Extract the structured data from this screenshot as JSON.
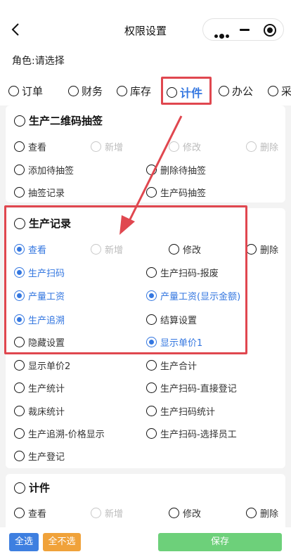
{
  "nav": {
    "title": "权限设置"
  },
  "role": {
    "label": "角色:请选择"
  },
  "tabs": [
    {
      "label": "订单"
    },
    {
      "label": "财务"
    },
    {
      "label": "库存"
    },
    {
      "label": "计件"
    },
    {
      "label": "办公"
    },
    {
      "label": "采"
    }
  ],
  "sections": [
    {
      "title": "生产二维码抽签",
      "options": [
        "查看",
        "新增",
        "修改",
        "删除",
        "添加待抽签",
        "删除待抽签",
        "抽签记录",
        "生产码抽签"
      ]
    },
    {
      "title": "生产记录",
      "options": [
        "查看",
        "新增",
        "修改",
        "删除",
        "生产扫码",
        "生产扫码-报废",
        "产量工资",
        "产量工资(显示金额)",
        "生产追溯",
        "结算设置",
        "隐藏设置",
        "显示单价1",
        "显示单价2",
        "生产合计",
        "生产统计",
        "生产扫码-直接登记",
        "裁床统计",
        "生产扫码统计",
        "生产追溯-价格显示",
        "生产扫码-选择员工",
        "生产登记"
      ]
    },
    {
      "title": "计件",
      "options": [
        "查看",
        "新增",
        "修改",
        "删除"
      ]
    }
  ],
  "footer": {
    "select_all": "全选",
    "select_none": "全不选",
    "save": "保存"
  },
  "colors": {
    "accent": "#3477e0",
    "annotation": "#e0474f",
    "save": "#6dd07a",
    "none": "#f0a23a"
  }
}
